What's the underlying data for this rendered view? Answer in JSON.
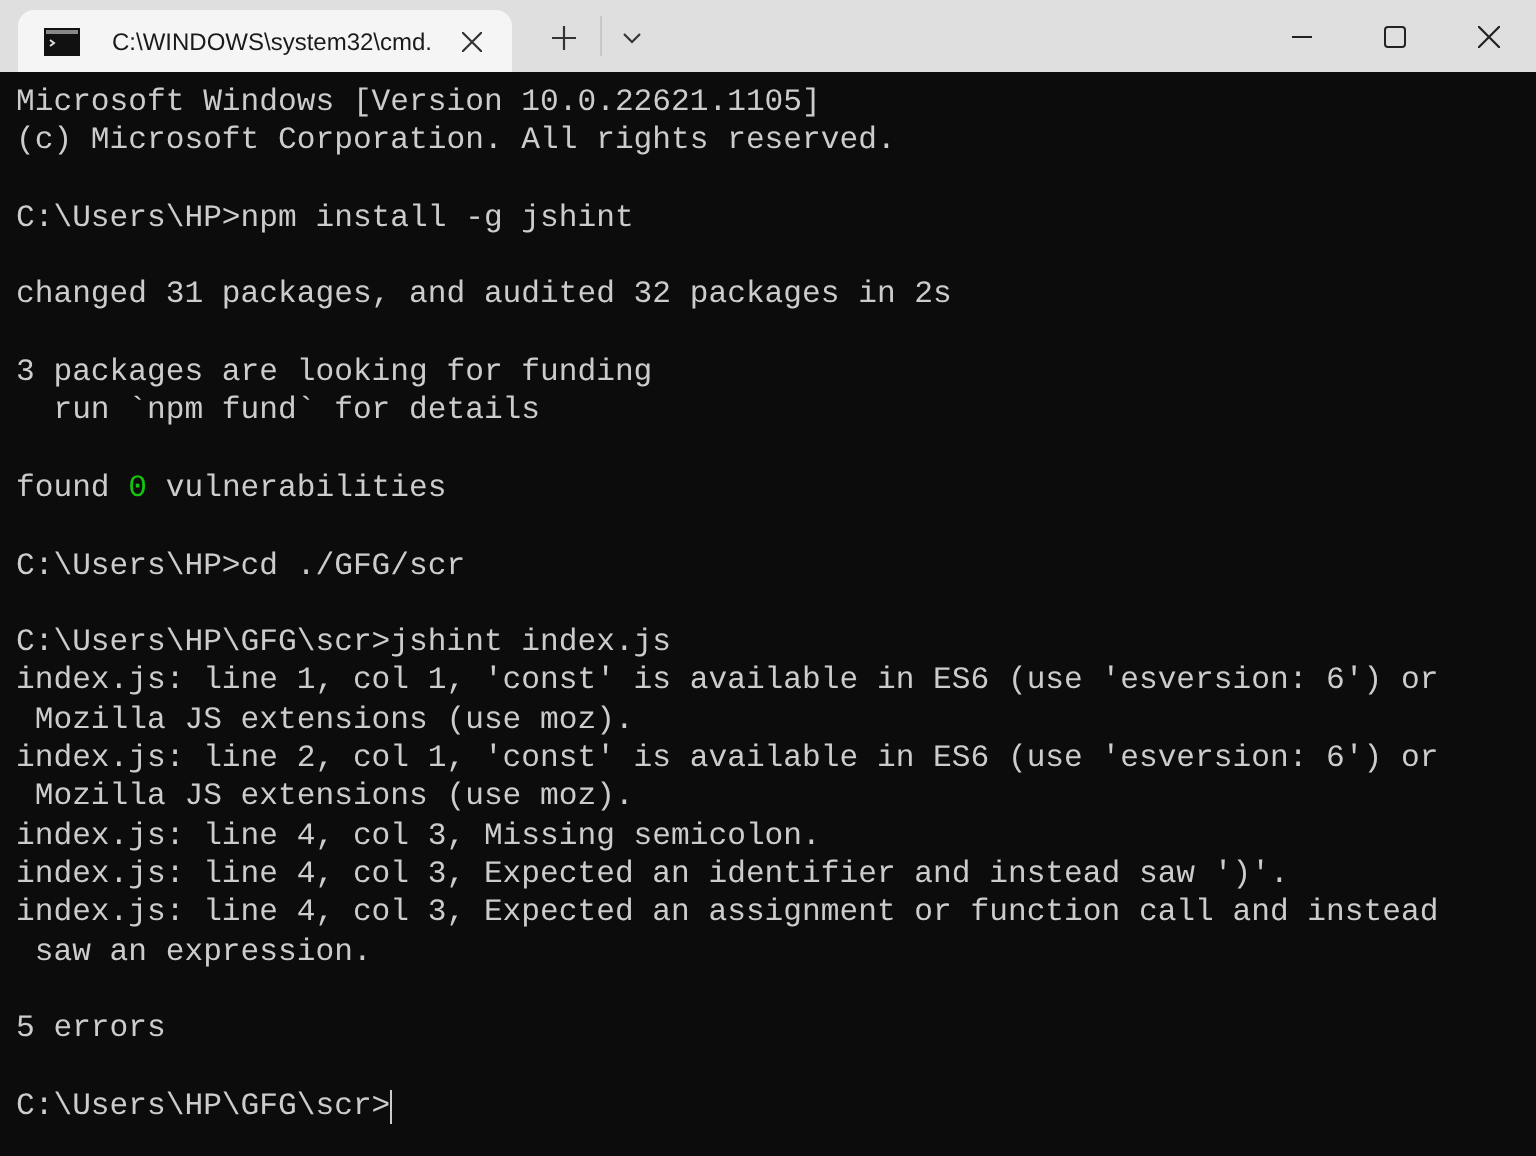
{
  "tabs": [
    {
      "title": "C:\\WINDOWS\\system32\\cmd.",
      "selected": true
    }
  ],
  "terminal": {
    "blocks": [
      [
        {
          "text": "Microsoft Windows [Version 10.0.22621.1105]"
        },
        {
          "text": "(c) Microsoft Corporation. All rights reserved."
        }
      ],
      [
        {
          "text": "C:\\Users\\HP>npm install -g jshint"
        }
      ],
      [
        {
          "text": "changed 31 packages, and audited 32 packages in 2s"
        }
      ],
      [
        {
          "text": "3 packages are looking for funding"
        },
        {
          "text": "  run `npm fund` for details"
        }
      ],
      [
        {
          "parts": [
            {
              "text": "found ",
              "kind": "plain"
            },
            {
              "text": "0",
              "kind": "success"
            },
            {
              "text": " vulnerabilities",
              "kind": "plain"
            }
          ]
        }
      ],
      [
        {
          "text": "C:\\Users\\HP>cd ./GFG/scr"
        }
      ],
      [
        {
          "text": "C:\\Users\\HP\\GFG\\scr>jshint index.js"
        },
        {
          "text": "index.js: line 1, col 1, 'const' is available in ES6 (use 'esversion: 6') or"
        },
        {
          "text": " Mozilla JS extensions (use moz)."
        },
        {
          "text": "index.js: line 2, col 1, 'const' is available in ES6 (use 'esversion: 6') or"
        },
        {
          "text": " Mozilla JS extensions (use moz)."
        },
        {
          "text": "index.js: line 4, col 3, Missing semicolon."
        },
        {
          "text": "index.js: line 4, col 3, Expected an identifier and instead saw ')'."
        },
        {
          "text": "index.js: line 4, col 3, Expected an assignment or function call and instead"
        },
        {
          "text": " saw an expression."
        }
      ],
      [
        {
          "text": "5 errors"
        }
      ]
    ],
    "prompt": {
      "text": "C:\\Users\\HP\\GFG\\scr>",
      "cursor": true
    }
  }
}
